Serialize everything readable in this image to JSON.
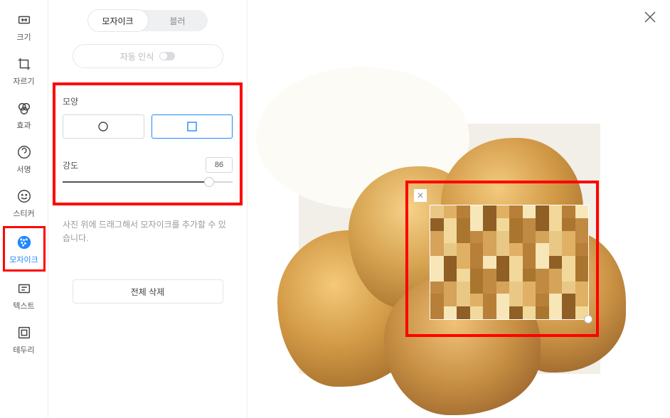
{
  "sidebar": {
    "items": [
      {
        "label": "크기",
        "icon": "resize"
      },
      {
        "label": "자르기",
        "icon": "crop"
      },
      {
        "label": "효과",
        "icon": "effect"
      },
      {
        "label": "서명",
        "icon": "signature"
      },
      {
        "label": "스티커",
        "icon": "sticker"
      },
      {
        "label": "모자이크",
        "icon": "mosaic"
      },
      {
        "label": "텍스트",
        "icon": "text"
      },
      {
        "label": "테두리",
        "icon": "border"
      }
    ]
  },
  "panel": {
    "seg": {
      "mosaic": "모자이크",
      "blur": "블러"
    },
    "auto_detect": "자동 인식",
    "shape_label": "모양",
    "intensity_label": "강도",
    "intensity_value": "86",
    "help_text": "사진 위에 드래그해서 모자이크를 추가할 수 있습니다.",
    "delete_all": "전체 삭제"
  }
}
